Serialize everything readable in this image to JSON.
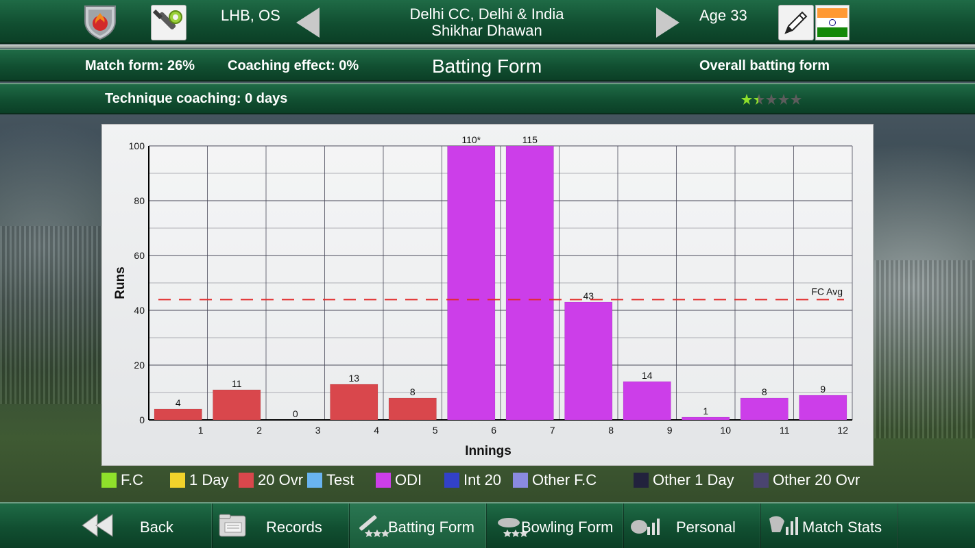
{
  "header": {
    "batting_style": "LHB, OS",
    "team": "Delhi CC, Delhi & India",
    "player_name": "Shikhar Dhawan",
    "age": "Age 33"
  },
  "form_row": {
    "match_form": "Match form: 26%",
    "coaching_effect": "Coaching effect: 0%",
    "title": "Batting Form",
    "overall_label": "Overall batting form"
  },
  "coaching_row": {
    "technique": "Technique coaching: 0 days",
    "rating_stars": 1.5,
    "max_stars": 5
  },
  "colors": {
    "accent_green": "#1f6b46",
    "twenty_ovr": "#d9474c",
    "odi": "#cc3ee9",
    "avg_line": "#e22a2a"
  },
  "chart_data": {
    "type": "bar",
    "xlabel": "Innings",
    "ylabel": "Runs",
    "ylim": [
      0,
      100
    ],
    "yticks": [
      "0",
      "20",
      "40",
      "60",
      "80",
      "100"
    ],
    "categories": [
      "1",
      "2",
      "3",
      "4",
      "5",
      "6",
      "7",
      "8",
      "9",
      "10",
      "11",
      "12"
    ],
    "values": [
      4,
      11,
      0,
      13,
      8,
      110,
      115,
      43,
      14,
      1,
      8,
      9
    ],
    "value_labels": [
      "4",
      "11",
      "0",
      "13",
      "8",
      "110*",
      "115",
      "43",
      "14",
      "1",
      "8",
      "9"
    ],
    "match_type": [
      "20 Ovr",
      "20 Ovr",
      "20 Ovr",
      "20 Ovr",
      "20 Ovr",
      "ODI",
      "ODI",
      "ODI",
      "ODI",
      "ODI",
      "ODI",
      "ODI"
    ],
    "reference_line": {
      "label": "FC Avg",
      "value": 43.9
    },
    "grid": true
  },
  "legend": [
    {
      "label": "F.C",
      "color": "#8fe02b"
    },
    {
      "label": "1 Day",
      "color": "#f2d32b"
    },
    {
      "label": "20 Ovr",
      "color": "#d9474c"
    },
    {
      "label": "Test",
      "color": "#69b4f0"
    },
    {
      "label": "ODI",
      "color": "#cc3ee9"
    },
    {
      "label": "Int 20",
      "color": "#3241c9"
    },
    {
      "label": "Other F.C",
      "color": "#8a8ae0"
    },
    {
      "label": "Other 1 Day",
      "color": "#22223d"
    },
    {
      "label": "Other 20 Ovr",
      "color": "#4a4470"
    }
  ],
  "nav": {
    "back": "Back",
    "records": "Records",
    "batting_form": "Batting Form",
    "bowling_form": "Bowling Form",
    "personal": "Personal",
    "match_stats": "Match Stats"
  }
}
